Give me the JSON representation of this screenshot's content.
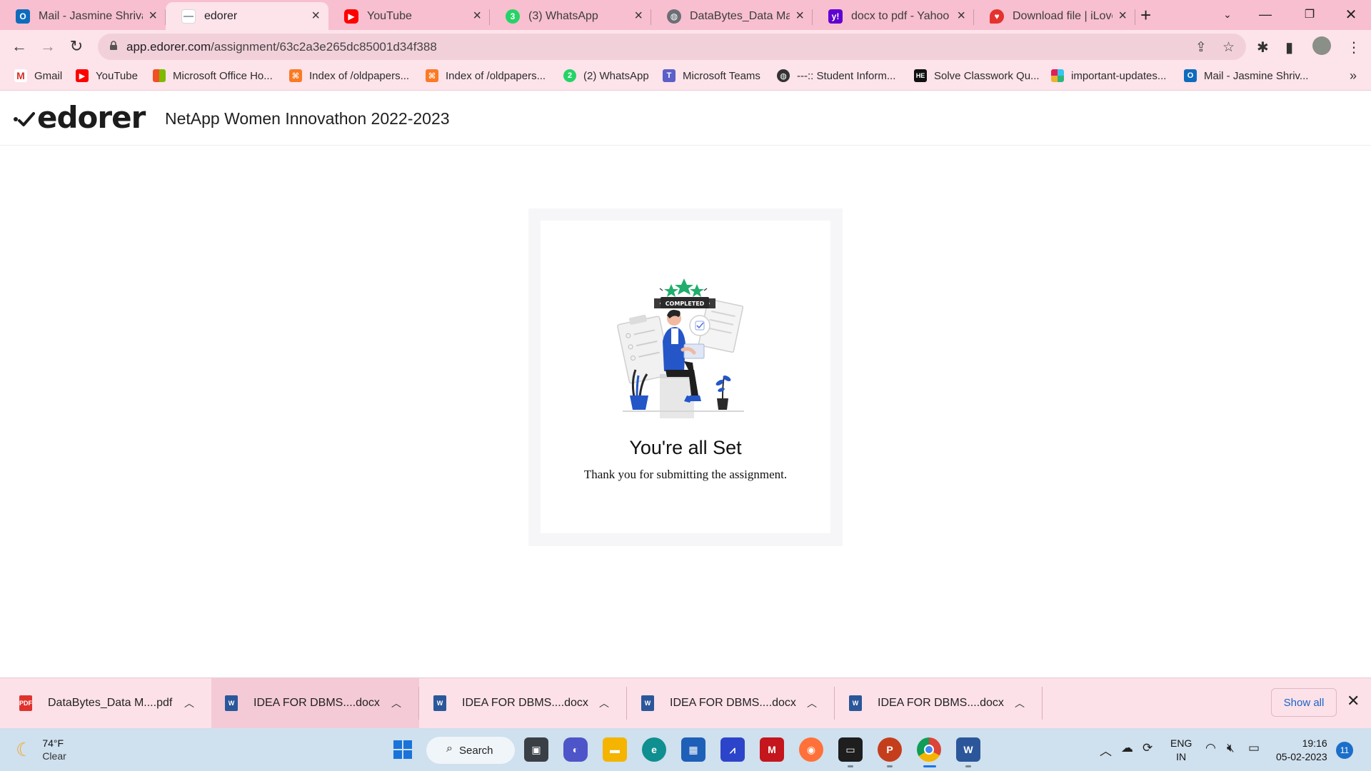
{
  "browser": {
    "tabs": [
      {
        "title": "Mail - Jasmine Shrivas",
        "icon": "outlook-icon",
        "color": "#0f6cbd"
      },
      {
        "title": "edorer",
        "icon": "edorer-favicon",
        "color": "#9aa3ad"
      },
      {
        "title": "YouTube",
        "icon": "youtube-icon",
        "color": "#ff0000"
      },
      {
        "title": "(3) WhatsApp",
        "icon": "whatsapp-icon",
        "color": "#25d366",
        "badge": "3"
      },
      {
        "title": "DataBytes_Data Mana",
        "icon": "globe-icon",
        "color": "#5f6368"
      },
      {
        "title": "docx to pdf - Yahoo I",
        "icon": "yahoo-icon",
        "color": "#6001d2"
      },
      {
        "title": "Download file | iLoveI",
        "icon": "ilovepdf-icon",
        "color": "#e5322d"
      }
    ],
    "active_tab": 1,
    "url_domain": "app.edorer.com",
    "url_path": "/assignment/63c2a3e265dc85001d34f388",
    "bookmarks": [
      {
        "label": "Gmail",
        "icon": "gmail-icon"
      },
      {
        "label": "YouTube",
        "icon": "youtube-icon"
      },
      {
        "label": "Microsoft Office Ho...",
        "icon": "office-icon"
      },
      {
        "label": "Index of /oldpapers...",
        "icon": "xampp-icon"
      },
      {
        "label": "Index of /oldpapers...",
        "icon": "xampp-icon"
      },
      {
        "label": "(2) WhatsApp",
        "icon": "whatsapp-icon"
      },
      {
        "label": "Microsoft Teams",
        "icon": "teams-icon"
      },
      {
        "label": "---:: Student Inform...",
        "icon": "globe-icon"
      },
      {
        "label": "Solve Classwork Qu...",
        "icon": "hackerearth-icon"
      },
      {
        "label": "important-updates...",
        "icon": "slack-icon"
      },
      {
        "label": "Mail - Jasmine Shriv...",
        "icon": "outlook-icon"
      }
    ]
  },
  "page": {
    "logo_text": "edorer",
    "program_title": "NetApp Women Innovathon 2022-2023",
    "badge_text": "COMPLETED",
    "heading": "You're all Set",
    "message": "Thank you for submitting the assignment."
  },
  "downloads": {
    "items": [
      {
        "name": "DataBytes_Data M....pdf",
        "type": "pdf"
      },
      {
        "name": "IDEA FOR DBMS....docx",
        "type": "docx"
      },
      {
        "name": "IDEA FOR DBMS....docx",
        "type": "docx"
      },
      {
        "name": "IDEA FOR DBMS....docx",
        "type": "docx"
      },
      {
        "name": "IDEA FOR DBMS....docx",
        "type": "docx"
      }
    ],
    "show_all": "Show all"
  },
  "taskbar": {
    "weather_temp": "74°F",
    "weather_cond": "Clear",
    "search_label": "Search",
    "lang_1": "ENG",
    "lang_2": "IN",
    "time": "19:16",
    "date": "05-02-2023",
    "notifications": "11"
  }
}
